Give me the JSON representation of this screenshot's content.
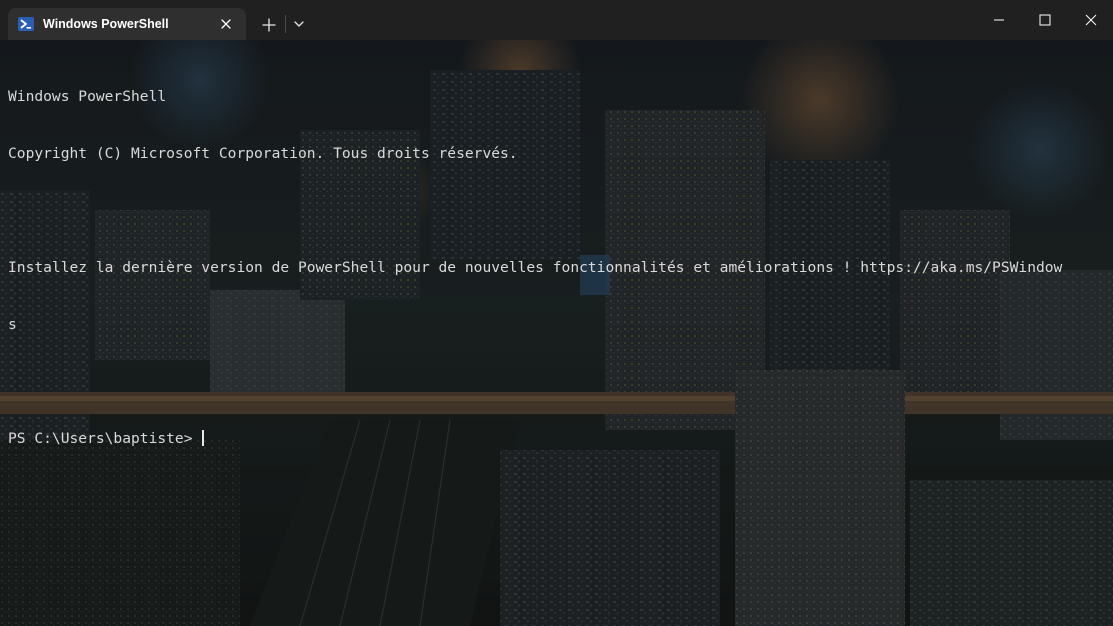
{
  "tab": {
    "title": "Windows PowerShell",
    "icon": "powershell-icon"
  },
  "titlebar": {
    "new_tab_icon": "plus-icon",
    "dropdown_icon": "chevron-down-icon",
    "minimize_icon": "minimize-icon",
    "maximize_icon": "maximize-icon",
    "close_icon": "close-icon"
  },
  "terminal": {
    "lines": [
      "Windows PowerShell",
      "Copyright (C) Microsoft Corporation. Tous droits réservés.",
      "",
      "Installez la dernière version de PowerShell pour de nouvelles fonctionnalités et améliorations ! https://aka.ms/PSWindow",
      "s",
      ""
    ],
    "prompt": "PS C:\\Users\\baptiste> ",
    "background": "night city skyline"
  },
  "colors": {
    "titlebar": "#202020",
    "active_tab": "#2f2f2f",
    "terminal_text": "#d9d9d9",
    "powershell_icon": "#2b5fb4"
  }
}
